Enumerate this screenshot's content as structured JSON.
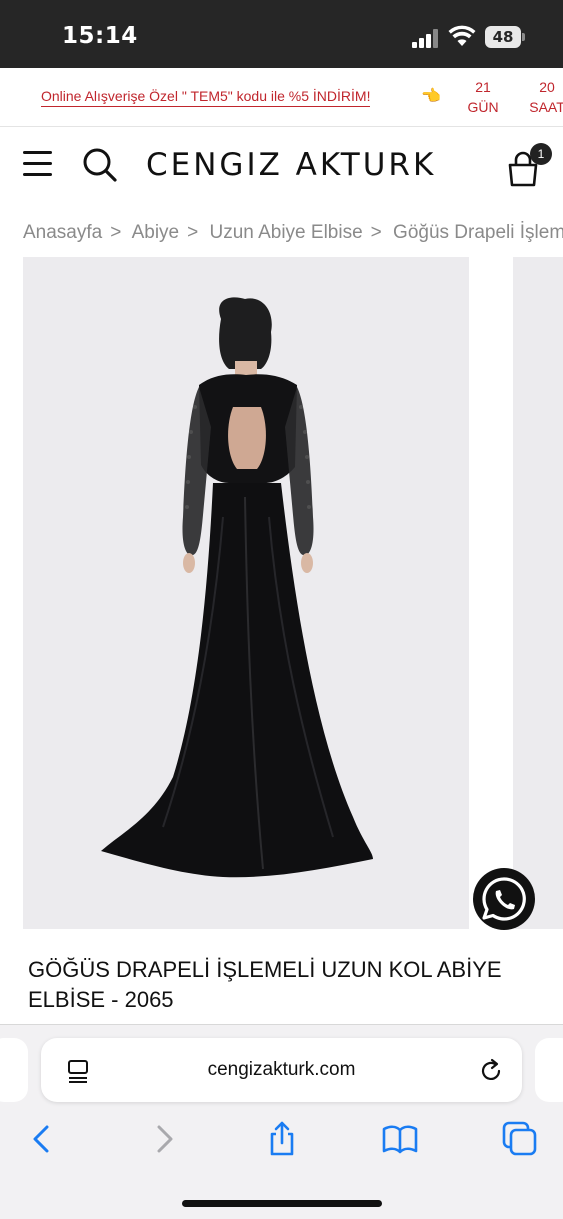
{
  "status_bar": {
    "time": "15:14",
    "battery": "48"
  },
  "promo": {
    "text": "Online Alışverişe Özel \" TEM5\" kodu ile %5 İNDİRİM!",
    "hand": "👈",
    "countdown": [
      {
        "value": "21",
        "unit": "GÜN"
      },
      {
        "value": "20",
        "unit": "SAAT"
      }
    ]
  },
  "header": {
    "logo": "CENGIZ AKTURK",
    "cart_count": "1"
  },
  "breadcrumb": [
    "Anasayfa",
    "Abiye",
    "Uzun Abiye Elbise",
    "Göğüs Drapeli İşlemeli"
  ],
  "breadcrumb_separator": ">",
  "product": {
    "title": "GÖĞÜS DRAPELİ İŞLEMELİ UZUN KOL ABİYE ELBİSE - 2065"
  },
  "browser": {
    "url": "cengizakturk.com"
  },
  "colors": {
    "accent": "#c0262d",
    "status_bar": "#262626",
    "photo_bg": "#ecebee",
    "ios_blue": "#1a7cf2"
  }
}
